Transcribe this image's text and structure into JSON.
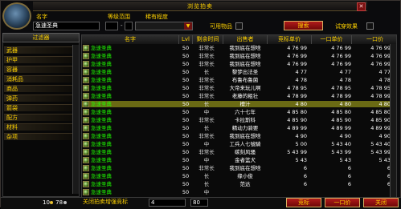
{
  "window": {
    "title": "浏览拍卖",
    "close_icon": "close-icon"
  },
  "search": {
    "name_label": "名字",
    "name_value": "急速圣典",
    "level_label": "等级范围",
    "level_sep": "-",
    "rarity_label": "稀有程度",
    "usable_label": "可用物品",
    "equip_label": "试穿效果",
    "search_button": "搜索"
  },
  "filter": {
    "header": "过滤器",
    "categories": [
      "武器",
      "护甲",
      "容器",
      "消耗品",
      "商品",
      "弹药",
      "箭袋",
      "配方",
      "材料",
      "杂项"
    ]
  },
  "columns": [
    "名字",
    "Lvl",
    "剩余时间",
    "出售者",
    "竞标单价",
    "一口单价",
    "一口价"
  ],
  "rows": [
    {
      "name": "急速圣典",
      "lvl": "50",
      "time": "非常长",
      "seller": "我到底在想啥",
      "bid": "4 76 99",
      "unit": "4 76 99",
      "buy": "4 76 99"
    },
    {
      "name": "急速圣典",
      "lvl": "50",
      "time": "非常长",
      "seller": "我到底在想啥",
      "bid": "4 76 99",
      "unit": "4 76 99",
      "buy": "4 76 99"
    },
    {
      "name": "急速圣典",
      "lvl": "50",
      "time": "非常长",
      "seller": "我到底在想啥",
      "bid": "4 76 99",
      "unit": "4 76 99",
      "buy": "4 76 99"
    },
    {
      "name": "急速圣典",
      "lvl": "50",
      "time": "长",
      "seller": "黎梦出法圣",
      "bid": "4 77",
      "unit": "4 77",
      "buy": "4 77"
    },
    {
      "name": "急速圣典",
      "lvl": "50",
      "time": "非常长",
      "seller": "布鲁布鲁菌",
      "bid": "4 78",
      "unit": "4 78",
      "buy": "4 78"
    },
    {
      "name": "急速圣典",
      "lvl": "50",
      "time": "非常长",
      "seller": "大帝来玩儿啊",
      "bid": "4 78 95",
      "unit": "4 78 95",
      "buy": "4 78 95"
    },
    {
      "name": "急速圣典",
      "lvl": "50",
      "time": "非常长",
      "seller": "老藤的粗壮",
      "bid": "4 78 99",
      "unit": "4 78 99",
      "buy": "4 78 99"
    },
    {
      "name": "急速圣典",
      "lvl": "50",
      "time": "长",
      "seller": "檀汁",
      "bid": "4 80",
      "unit": "4 80",
      "buy": "4 80"
    },
    {
      "name": "急速圣典",
      "lvl": "50",
      "time": "中",
      "seller": "六十七年",
      "bid": "4 85 80",
      "unit": "4 85 80",
      "buy": "4 85 80"
    },
    {
      "name": "急速圣典",
      "lvl": "50",
      "time": "非常长",
      "seller": "卡拉斯科",
      "bid": "4 85 90",
      "unit": "4 85 90",
      "buy": "4 85 90"
    },
    {
      "name": "急速圣典",
      "lvl": "50",
      "time": "长",
      "seller": "精动力骑要",
      "bid": "4 89 99",
      "unit": "4 89 99",
      "buy": "4 89 99"
    },
    {
      "name": "急速圣典",
      "lvl": "50",
      "time": "非常长",
      "seller": "我到底在想啥",
      "bid": "4 90",
      "unit": "4 90",
      "buy": "4 90"
    },
    {
      "name": "急速圣典",
      "lvl": "50",
      "time": "中",
      "seller": "工兵人七號騎",
      "bid": "5 00",
      "unit": "5 43 40",
      "buy": "5 43 40"
    },
    {
      "name": "急速圣典",
      "lvl": "50",
      "time": "非常长",
      "seller": "碳刻风骚",
      "bid": "5 43 99",
      "unit": "5 43 99",
      "buy": "5 43 99"
    },
    {
      "name": "急速圣典",
      "lvl": "50",
      "time": "中",
      "seller": "金者篮犬",
      "bid": "5 43",
      "unit": "5 43",
      "buy": "5 43"
    },
    {
      "name": "急速圣典",
      "lvl": "50",
      "time": "非常长",
      "seller": "我到底在想啥",
      "bid": "6",
      "unit": "6",
      "buy": "6"
    },
    {
      "name": "急速圣典",
      "lvl": "50",
      "time": "长",
      "seller": "缘小俊",
      "bid": "6",
      "unit": "6",
      "buy": "6"
    },
    {
      "name": "急速圣典",
      "lvl": "50",
      "time": "长",
      "seller": "范达",
      "bid": "6",
      "unit": "6",
      "buy": "6"
    },
    {
      "name": "急速圣典",
      "lvl": "50",
      "time": "中",
      "seller": "",
      "bid": "",
      "unit": "",
      "buy": ""
    }
  ],
  "selected_row": 7,
  "bottom": {
    "money_gold": "10",
    "money_silver": "78",
    "close_label": "关闭拍卖增强竞标",
    "bid_gold": "4",
    "bid_silver": "80",
    "bid_button": "竞标",
    "buyout_button": "一口价",
    "close_button": "关闭"
  }
}
